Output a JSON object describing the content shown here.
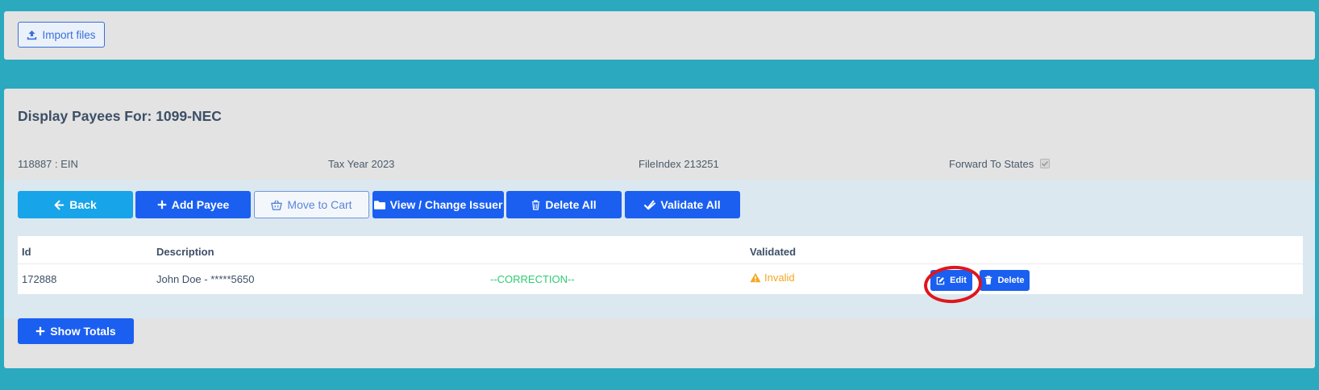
{
  "top_panel": {
    "import_label": "Import files"
  },
  "main": {
    "title": "Display Payees For: 1099-NEC",
    "ein": "118887 : EIN",
    "tax_year": "Tax Year 2023",
    "file_index": "FileIndex 213251",
    "forward_to_states": "Forward To States",
    "forward_to_states_checked": true
  },
  "toolbar": {
    "back_label": "Back",
    "add_payee_label": "Add Payee",
    "move_to_cart_label": "Move to Cart",
    "view_change_issuer_label": "View / Change Issuer",
    "delete_all_label": "Delete All",
    "validate_all_label": "Validate All"
  },
  "table": {
    "headers": [
      "Id",
      "",
      "Description",
      "Validated"
    ],
    "rows": [
      {
        "id": "172888",
        "description": "John Doe - *****5650",
        "status": "--CORRECTION--",
        "validated": "Invalid",
        "edit_label": "Edit",
        "delete_label": "Delete"
      }
    ]
  },
  "footer": {
    "show_totals_label": "Show Totals"
  },
  "colors": {
    "background": "#2aa9bf",
    "primary": "#1a5ff0",
    "info": "#18a4e8",
    "correction": "#2ecc71",
    "warning": "#f5a623",
    "highlight": "#e0151c"
  },
  "icons": {
    "import": "upload-icon",
    "back": "arrow-left-icon",
    "add": "plus-icon",
    "cart": "basket-icon",
    "issuer": "folder-icon",
    "delete": "trash-icon",
    "validate": "check-double-icon",
    "warning": "warning-icon",
    "edit": "edit-icon"
  }
}
